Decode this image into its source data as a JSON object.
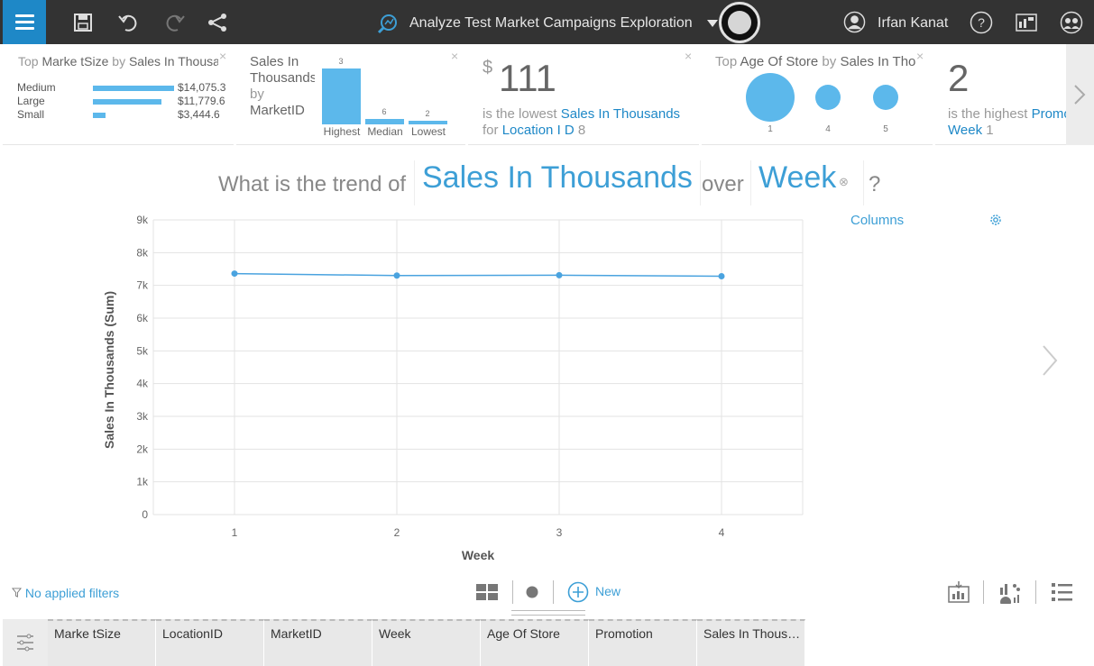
{
  "header": {
    "app_title": "Analyze Test Market Campaigns Exploration",
    "user_name": "Irfan Kanat"
  },
  "cards": {
    "card1": {
      "prefix": "Top",
      "dimension": "Marke tSize",
      "by": "by",
      "measure": "Sales In Thousands",
      "rows": [
        {
          "label": "Medium",
          "value": "$14,075.3",
          "fraction": 1.0
        },
        {
          "label": "Large",
          "value": "$11,779.6",
          "fraction": 0.84
        },
        {
          "label": "Small",
          "value": "$3,444.6",
          "fraction": 0.16
        }
      ]
    },
    "card2": {
      "title_line1": "Sales In",
      "title_line2": "Thousands",
      "title_line3": "by",
      "title_line4": "MarketID",
      "bars": [
        {
          "id": "3",
          "label": "Highest",
          "fraction": 1.0
        },
        {
          "id": "6",
          "label": "Median",
          "fraction": 0.1
        },
        {
          "id": "2",
          "label": "Lowest",
          "fraction": 0.07
        }
      ]
    },
    "card3": {
      "currency": "$",
      "value": "111",
      "line1_text": "is the lowest",
      "line1_measure": "Sales In Thousands",
      "line2_text": "for",
      "line2_dimension": "Location I D",
      "line2_value": "8"
    },
    "card4": {
      "prefix": "Top",
      "dimension": "Age Of Store",
      "by": "by",
      "measure": "Sales In Thousands",
      "dots": [
        {
          "label": "1",
          "fraction": 1.0
        },
        {
          "label": "4",
          "fraction": 0.28
        },
        {
          "label": "5",
          "fraction": 0.28
        }
      ]
    },
    "card5": {
      "value": "2",
      "line1_text": "is the highest",
      "line1_dimension": "Promotion",
      "line2_dimension": "Week",
      "line2_value": "1"
    }
  },
  "question": {
    "lead": "What is the trend of",
    "measure": "Sales In Thousands",
    "connector": "over",
    "dimension": "Week",
    "end": "?"
  },
  "chart_panel": {
    "columns_label": "Columns"
  },
  "chart_data": {
    "type": "line",
    "x": [
      1,
      2,
      3,
      4
    ],
    "x_tick_labels": [
      "1",
      "2",
      "3",
      "4"
    ],
    "series": [
      {
        "values": [
          7360,
          7300,
          7310,
          7280
        ]
      }
    ],
    "xlabel": "Week",
    "ylabel": "Sales In Thousands (Sum)",
    "ylim": [
      0,
      9000
    ],
    "y_ticks": [
      0,
      1000,
      2000,
      3000,
      4000,
      5000,
      6000,
      7000,
      8000,
      9000
    ],
    "y_tick_labels": [
      "0",
      "1k",
      "2k",
      "3k",
      "4k",
      "5k",
      "6k",
      "7k",
      "8k",
      "9k"
    ],
    "grid": true,
    "color": "#4aa3df"
  },
  "footer": {
    "filters_label": "No applied filters",
    "new_label": "New"
  },
  "table": {
    "columns": [
      "Marke tSize",
      "LocationID",
      "MarketID",
      "Week",
      "Age Of Store",
      "Promotion",
      "Sales In Thous…"
    ]
  },
  "colors": {
    "accent": "#1e88c7",
    "link": "#3d9fd6",
    "bar": "#5cb8eb",
    "topbar": "#333333"
  }
}
